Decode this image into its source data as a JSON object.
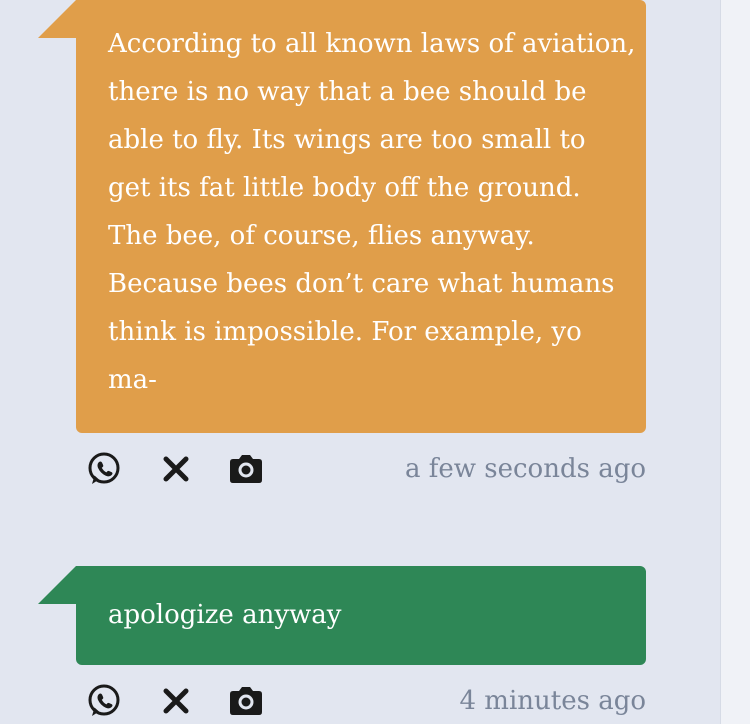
{
  "messages": [
    {
      "text": "According to all known laws of aviation, there is no way that a bee should be able to fly. Its wings are too small to get its fat little body off the ground. The bee, of course, flies anyway. Because bees don’t care what humans think is impossible. For example, yo ma-",
      "color": "#e09e4a",
      "timestamp": "a few seconds ago",
      "actions": [
        "whatsapp-icon",
        "close-icon",
        "camera-icon"
      ]
    },
    {
      "text": "apologize anyway",
      "color": "#2e8756",
      "timestamp": "4 minutes ago",
      "actions": [
        "whatsapp-icon",
        "close-icon",
        "camera-icon"
      ]
    }
  ],
  "colors": {
    "background": "#e2e6f0",
    "icon": "#1a1a1a",
    "timestamp": "#7a8599"
  }
}
